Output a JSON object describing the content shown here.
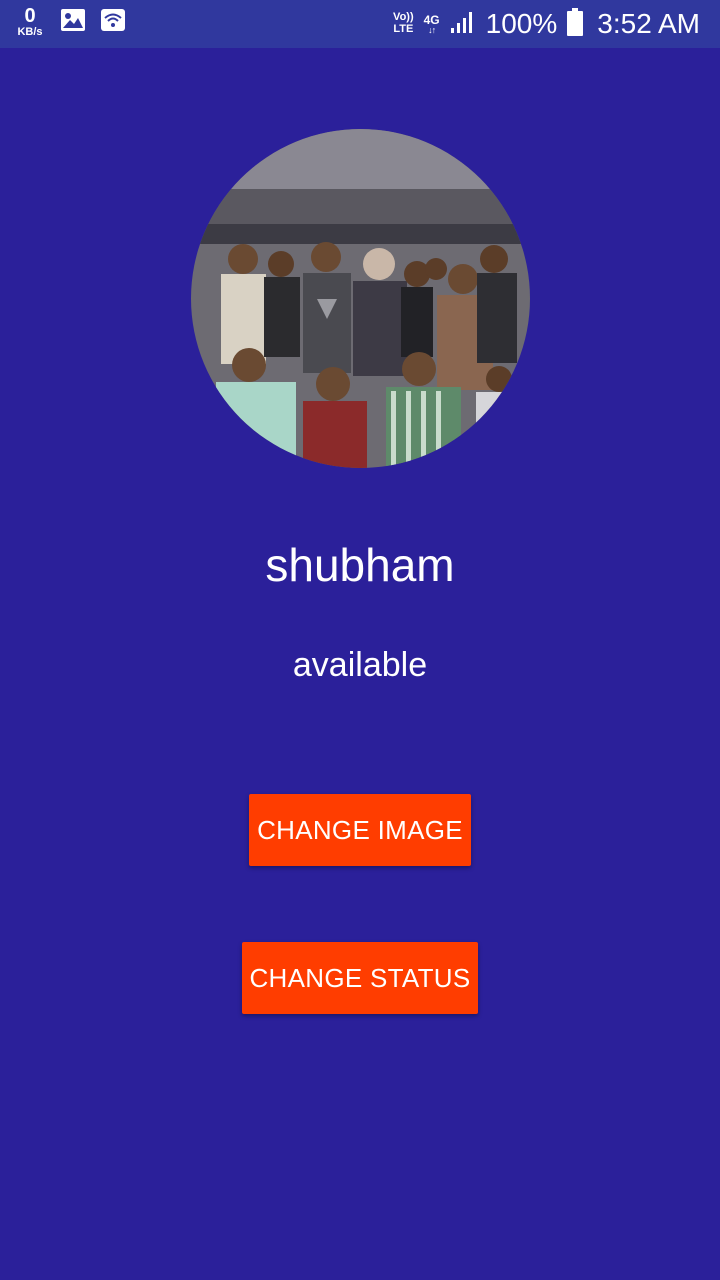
{
  "status_bar": {
    "speed_value": "0",
    "speed_unit": "KB/s",
    "volte_top": "Vo))",
    "volte_bottom": "LTE",
    "network_type": "4G",
    "network_arrows": "↓↑",
    "battery_percent": "100%",
    "time": "3:52 AM",
    "icons": [
      "gallery-icon",
      "wifi-hotspot-icon",
      "signal-icon",
      "battery-icon"
    ]
  },
  "profile": {
    "name": "shubham",
    "status": "available",
    "avatar_description_icon": "group-photo-avatar"
  },
  "actions": {
    "change_image_label": "CHANGE IMAGE",
    "change_status_label": "CHANGE STATUS"
  },
  "colors": {
    "background": "#2b209a",
    "status_bar": "#30389e",
    "button": "#ff3d00",
    "text": "#ffffff"
  }
}
